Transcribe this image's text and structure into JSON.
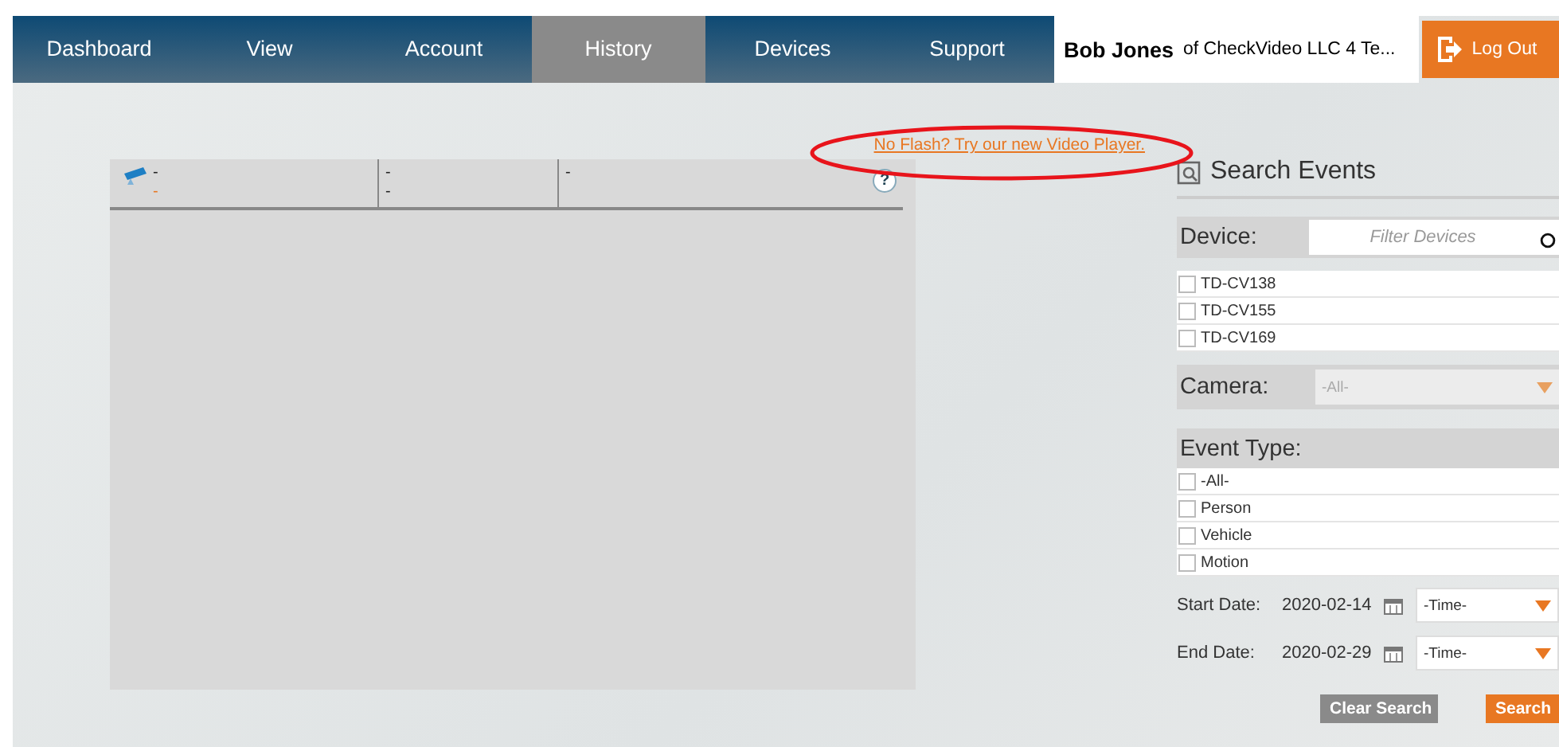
{
  "nav": {
    "tabs": [
      {
        "label": "Dashboard",
        "selected": false
      },
      {
        "label": "View",
        "selected": false
      },
      {
        "label": "Account",
        "selected": false
      },
      {
        "label": "History",
        "selected": true
      },
      {
        "label": "Devices",
        "selected": false
      },
      {
        "label": "Support",
        "selected": false
      }
    ],
    "user": {
      "name": "Bob Jones",
      "org": "of CheckVideo LLC 4 Te..."
    },
    "logout": "Log Out"
  },
  "player": {
    "link": "No Flash? Try our new Video Player.",
    "help": "?",
    "columns": [
      {
        "lines": [
          "-",
          "-"
        ]
      },
      {
        "lines": [
          "-",
          "-"
        ]
      },
      {
        "lines": [
          "-"
        ]
      }
    ]
  },
  "annotation": {
    "kind": "ellipse"
  },
  "search": {
    "title": "Search Events",
    "device": {
      "label": "Device:",
      "placeholder": "Filter Devices",
      "items": [
        {
          "label": "TD-CV138",
          "checked": false
        },
        {
          "label": "TD-CV155",
          "checked": false
        },
        {
          "label": "TD-CV169",
          "checked": false
        }
      ]
    },
    "camera": {
      "label": "Camera:",
      "value": "-All-"
    },
    "event_type": {
      "label": "Event Type:",
      "items": [
        {
          "label": "-All-",
          "checked": false
        },
        {
          "label": "Person",
          "checked": false
        },
        {
          "label": "Vehicle",
          "checked": false
        },
        {
          "label": "Motion",
          "checked": false
        }
      ]
    },
    "dates": [
      {
        "label": "Start Date:",
        "date": "2020-02-14",
        "time": "-Time-"
      },
      {
        "label": "End Date:",
        "date": "2020-02-29",
        "time": "-Time-"
      }
    ],
    "buttons": [
      {
        "label": "Clear Search",
        "kind": "secondary"
      },
      {
        "label": "Search",
        "kind": "primary"
      }
    ]
  }
}
